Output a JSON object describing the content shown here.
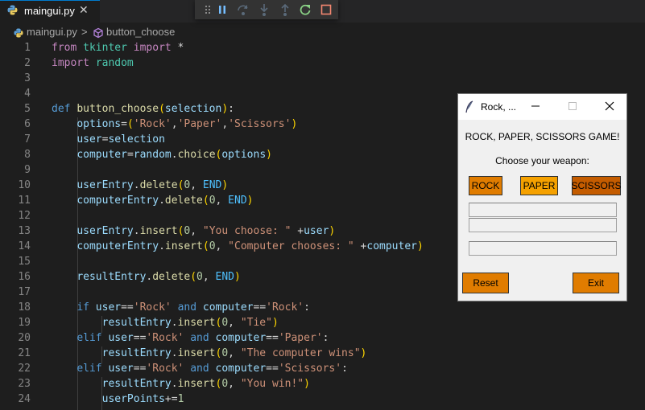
{
  "tab": {
    "filename": "maingui.py",
    "close_glyph": "✕"
  },
  "debug_toolbar": {
    "buttons": [
      "gripper-icon",
      "pause-icon",
      "step-over-icon",
      "step-into-icon",
      "step-out-icon",
      "restart-icon",
      "stop-icon"
    ]
  },
  "breadcrumb": {
    "file": "maingui.py",
    "separator": ">",
    "symbol": "button_choose"
  },
  "editor": {
    "line_numbers": [
      "1",
      "2",
      "3",
      "4",
      "5",
      "6",
      "7",
      "8",
      "9",
      "10",
      "11",
      "12",
      "13",
      "14",
      "15",
      "16",
      "17",
      "18",
      "19",
      "20",
      "21",
      "22",
      "23",
      "24"
    ],
    "lines": [
      "from tkinter import *",
      "import random",
      "",
      "",
      "def button_choose(selection):",
      "    options=('Rock','Paper','Scissors')",
      "    user=selection",
      "    computer=random.choice(options)",
      "",
      "    userEntry.delete(0, END)",
      "    computerEntry.delete(0, END)",
      "",
      "    userEntry.insert(0, \"You choose: \" +user)",
      "    computerEntry.insert(0, \"Computer chooses: \" +computer)",
      "",
      "    resultEntry.delete(0, END)",
      "",
      "    if user=='Rock' and computer=='Rock':",
      "        resultEntry.insert(0, \"Tie\")",
      "    elif user=='Rock' and computer=='Paper':",
      "        resultEntry.insert(0, \"The computer wins\")",
      "    elif user=='Rock' and computer=='Scissors':",
      "        resultEntry.insert(0, \"You win!\")",
      "        userPoints+=1"
    ]
  },
  "tk_window": {
    "title": "Rock, ...",
    "heading": "ROCK, PAPER, SCISSORS GAME!",
    "prompt": "Choose your weapon:",
    "buttons": {
      "rock": "ROCK",
      "paper": "PAPER",
      "scissors": "SCISSORS",
      "reset": "Reset",
      "exit": "Exit"
    },
    "entries": {
      "user": "",
      "computer": "",
      "result": ""
    }
  },
  "colors": {
    "editor_bg": "#1e1e1e",
    "tab_accent": "#007acc",
    "rock_button": "#e07c00",
    "paper_button": "#f5a100",
    "scissors_button": "#c45c00",
    "reset_button": "#e07c00",
    "exit_button": "#e07c00"
  }
}
